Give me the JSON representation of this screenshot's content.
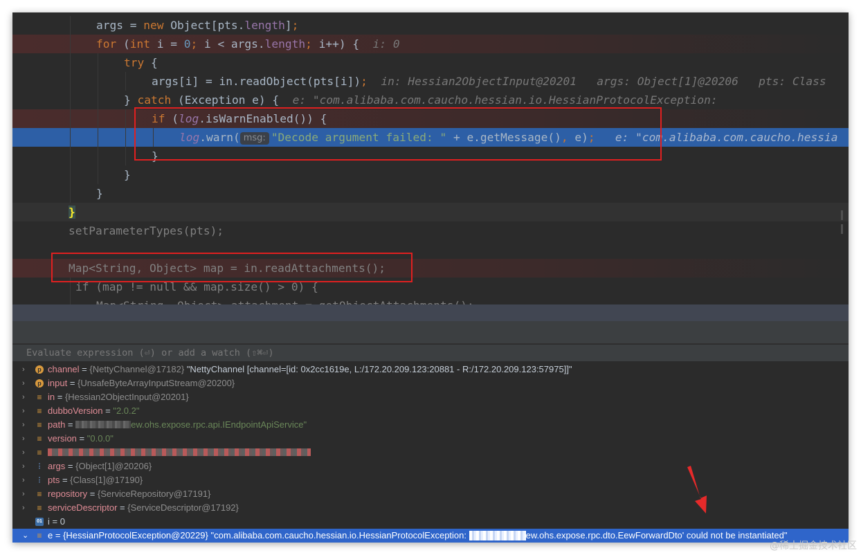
{
  "editor": {
    "lines": [
      {
        "id": "l1",
        "tokens": [
          {
            "t": "args = "
          },
          {
            "t": "new ",
            "c": "kw"
          },
          {
            "t": "Object[pts."
          },
          {
            "t": "length",
            "c": "field"
          },
          {
            "t": "]"
          },
          {
            "t": ";",
            "c": "kw"
          }
        ]
      },
      {
        "id": "l2",
        "tokens": [
          {
            "t": "for ",
            "c": "kw"
          },
          {
            "t": "("
          },
          {
            "t": "int ",
            "c": "kw"
          },
          {
            "t": "i = "
          },
          {
            "t": "0",
            "c": "num"
          },
          {
            "t": "; ",
            "c": "kw"
          },
          {
            "t": "i < args."
          },
          {
            "t": "length",
            "c": "field"
          },
          {
            "t": "; ",
            "c": "kw"
          },
          {
            "t": "i++) {  "
          },
          {
            "t": "i: 0",
            "c": "hint"
          }
        ]
      },
      {
        "id": "l3",
        "tokens": [
          {
            "t": "try ",
            "c": "kw"
          },
          {
            "t": "{"
          }
        ]
      },
      {
        "id": "l4",
        "tokens": [
          {
            "t": "args[i] = in.readObject(pts[i])"
          },
          {
            "t": ";  ",
            "c": "kw"
          },
          {
            "t": "in: Hessian2ObjectInput@20201   args: Object[1]@20206   pts: Class",
            "c": "hint"
          }
        ]
      },
      {
        "id": "l5",
        "tokens": [
          {
            "t": "} "
          },
          {
            "t": "catch ",
            "c": "kw"
          },
          {
            "t": "(Exception e) {  "
          },
          {
            "t": "e: \"com.alibaba.com.caucho.hessian.io.HessianProtocolException: ",
            "c": "hint"
          }
        ]
      },
      {
        "id": "l6",
        "tokens": [
          {
            "t": "if ",
            "c": "kw"
          },
          {
            "t": "("
          },
          {
            "t": "log",
            "c": "fieldit"
          },
          {
            "t": ".isWarnEnabled()) {"
          }
        ]
      },
      {
        "id": "l7",
        "tokens": [
          {
            "t": "log",
            "c": "fieldit"
          },
          {
            "t": ".warn("
          },
          {
            "t": "msg:",
            "c": "chip"
          },
          {
            "t": "\"Decode argument failed: \"",
            "c": "str"
          },
          {
            "t": " + e.getMessage()"
          },
          {
            "t": ", ",
            "c": "kw"
          },
          {
            "t": "e)"
          },
          {
            "t": ";   ",
            "c": "kw"
          },
          {
            "t": "e: \"com.alibaba.com.caucho.hessia",
            "c": "hint"
          }
        ]
      },
      {
        "id": "l8",
        "tokens": [
          {
            "t": "}"
          }
        ]
      },
      {
        "id": "l9",
        "tokens": [
          {
            "t": "}"
          }
        ]
      },
      {
        "id": "l10",
        "tokens": [
          {
            "t": "}"
          }
        ]
      },
      {
        "id": "l11",
        "tokens": [
          {
            "t": "}",
            "c": "curbrace"
          }
        ]
      },
      {
        "id": "l12",
        "tokens": [
          {
            "t": "setParameterTypes(pts);",
            "c": "gray"
          }
        ]
      },
      {
        "id": "l13",
        "tokens": []
      },
      {
        "id": "l14",
        "tokens": [
          {
            "t": "Map<String, Object> map = in.readAttachments();",
            "c": "gray"
          }
        ]
      },
      {
        "id": "l15",
        "tokens": [
          {
            "t": "if (map != null && map.size() > 0) {",
            "c": "gray"
          }
        ]
      },
      {
        "id": "l16",
        "tokens": [
          {
            "t": "Map<String, Object> attachment = getObjectAttachments();",
            "c": "gray"
          }
        ]
      }
    ]
  },
  "debugger": {
    "evaluate_placeholder": "Evaluate expression (⏎) or add a watch (⇧⌘⏎)",
    "variables": [
      {
        "icon": "p",
        "name": "channel",
        "type": "{NettyChannel@17182}",
        "value": "\"NettyChannel [channel=[id: 0x2cc1619e, L:/172.20.209.123:20881 - R:/172.20.209.123:57975]]\"",
        "expand": true
      },
      {
        "icon": "p",
        "name": "input",
        "type": "{UnsafeByteArrayInputStream@20200}",
        "value": "",
        "expand": true
      },
      {
        "icon": "f",
        "name": "in",
        "type": "{Hessian2ObjectInput@20201}",
        "value": "",
        "expand": true
      },
      {
        "icon": "f",
        "name": "dubboVersion",
        "type": "",
        "value": "\"2.0.2\"",
        "expand": true,
        "str": true
      },
      {
        "icon": "f",
        "name": "path",
        "type": "",
        "value": "ew.ohs.expose.rpc.api.IEndpointApiService\"",
        "expand": true,
        "str": true,
        "blur_before": 80
      },
      {
        "icon": "f",
        "name": "version",
        "type": "",
        "value": "\"0.0.0\"",
        "expand": true,
        "str": true
      },
      {
        "icon": "f",
        "name": "",
        "type": "",
        "value": "",
        "expand": true,
        "blur_line": 380
      },
      {
        "icon": "a",
        "name": "args",
        "type": "{Object[1]@20206}",
        "value": "",
        "expand": true
      },
      {
        "icon": "a",
        "name": "pts",
        "type": "{Class[1]@17190}",
        "value": "",
        "expand": true
      },
      {
        "icon": "f",
        "name": "repository",
        "type": "{ServiceRepository@17191}",
        "value": "",
        "expand": true
      },
      {
        "icon": "f",
        "name": "serviceDescriptor",
        "type": "{ServiceDescriptor@17192}",
        "value": "",
        "expand": true
      },
      {
        "icon": "i",
        "name": "i",
        "type": "",
        "value": "0",
        "expand": false,
        "plain": true
      },
      {
        "icon": "f",
        "name": "e",
        "type": "{HessianProtocolException@20229}",
        "value": "\"com.alibaba.com.caucho.hessian.io.HessianProtocolException: ",
        "value2": "ew.ohs.expose.rpc.dto.EewForwardDto' could not be instantiated\"",
        "expand": true,
        "selected": true
      }
    ]
  },
  "watermark": "@稀土掘金技术社区",
  "colors": {
    "error_box": "#e02020",
    "current_line": "#2d5fa6",
    "selected_var": "#2f65ca"
  }
}
